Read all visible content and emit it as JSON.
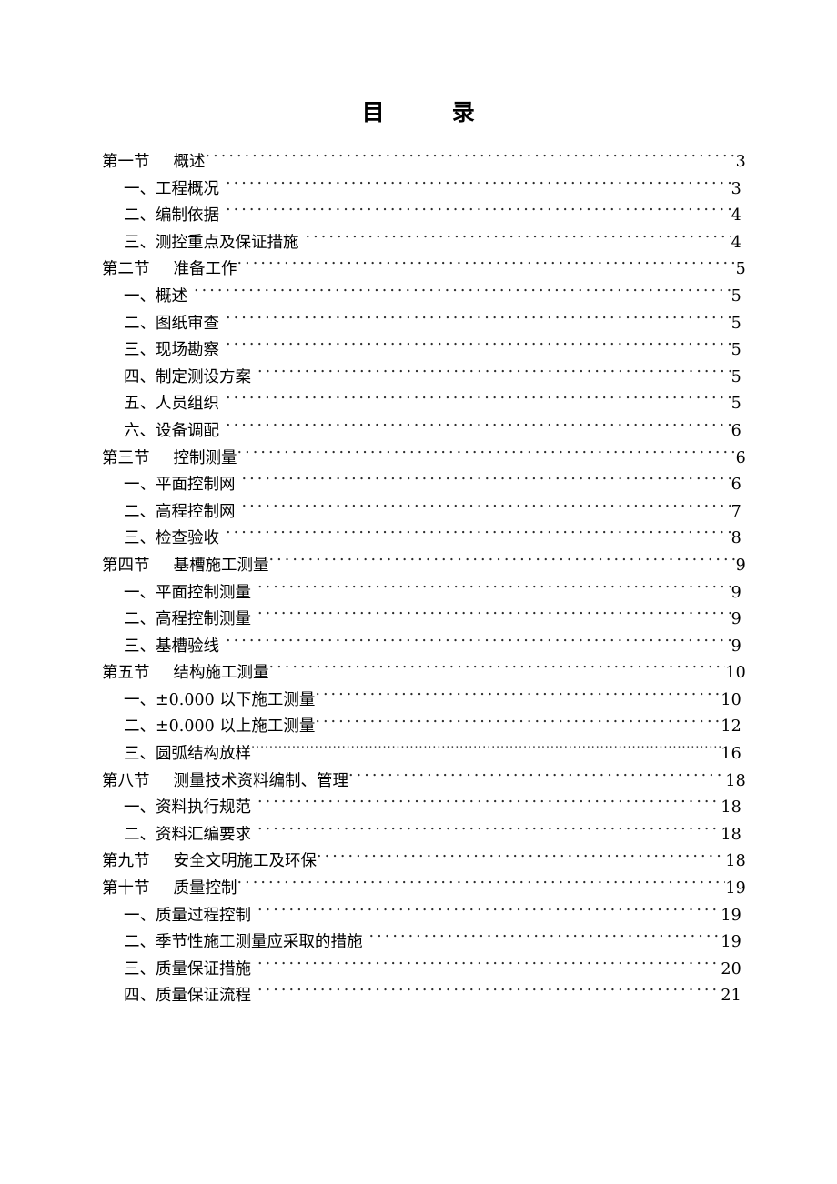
{
  "document": {
    "title": "目        录",
    "title_plain": "目 录"
  },
  "toc": {
    "entries": [
      {
        "level": 1,
        "section": "第一节",
        "text": "概述",
        "page": "3",
        "leader": "normal",
        "gap_before": false
      },
      {
        "level": 2,
        "section": "",
        "text": "一、工程概况",
        "page": "3",
        "leader": "normal",
        "gap_before": true
      },
      {
        "level": 2,
        "section": "",
        "text": "二、编制依据",
        "page": "4",
        "leader": "normal",
        "gap_before": true
      },
      {
        "level": 2,
        "section": "",
        "text": "三、测控重点及保证措施",
        "page": "4",
        "leader": "normal",
        "gap_before": true
      },
      {
        "level": 1,
        "section": "第二节",
        "text": "准备工作",
        "page": "5",
        "leader": "normal",
        "gap_before": false
      },
      {
        "level": 2,
        "section": "",
        "text": "一、概述",
        "page": "5",
        "leader": "normal",
        "gap_before": true
      },
      {
        "level": 2,
        "section": "",
        "text": "二、图纸审查",
        "page": "5",
        "leader": "normal",
        "gap_before": true
      },
      {
        "level": 2,
        "section": "",
        "text": "三、现场勘察",
        "page": "5",
        "leader": "normal",
        "gap_before": true
      },
      {
        "level": 2,
        "section": "",
        "text": "四、制定测设方案",
        "page": "5",
        "leader": "normal",
        "gap_before": true
      },
      {
        "level": 2,
        "section": "",
        "text": "五、人员组织",
        "page": "5",
        "leader": "normal",
        "gap_before": true
      },
      {
        "level": 2,
        "section": "",
        "text": "六、设备调配",
        "page": "6",
        "leader": "normal",
        "gap_before": true
      },
      {
        "level": 1,
        "section": "第三节",
        "text": "控制测量",
        "page": "6",
        "leader": "normal",
        "gap_before": false
      },
      {
        "level": 2,
        "section": "",
        "text": "一、平面控制网",
        "page": "6",
        "leader": "normal",
        "gap_before": true
      },
      {
        "level": 2,
        "section": "",
        "text": "二、高程控制网",
        "page": "7",
        "leader": "normal",
        "gap_before": true
      },
      {
        "level": 2,
        "section": "",
        "text": "三、检查验收",
        "page": "8",
        "leader": "normal",
        "gap_before": true
      },
      {
        "level": 1,
        "section": "第四节",
        "text": "基槽施工测量",
        "page": "9",
        "leader": "normal",
        "gap_before": false
      },
      {
        "level": 2,
        "section": "",
        "text": "一、平面控制测量",
        "page": "9",
        "leader": "normal",
        "gap_before": true
      },
      {
        "level": 2,
        "section": "",
        "text": "二、高程控制测量",
        "page": "9",
        "leader": "normal",
        "gap_before": true
      },
      {
        "level": 2,
        "section": "",
        "text": "三、基槽验线",
        "page": "9",
        "leader": "normal",
        "gap_before": true
      },
      {
        "level": 1,
        "section": "第五节",
        "text": "结构施工测量",
        "page": "10",
        "leader": "normal",
        "gap_before": false
      },
      {
        "level": 2,
        "section": "",
        "text": "一、±0.000 以下施工测量",
        "page": "10",
        "leader": "normal",
        "gap_before": false
      },
      {
        "level": 2,
        "section": "",
        "text": "二、±0.000 以上施工测量",
        "page": "12",
        "leader": "normal",
        "gap_before": false
      },
      {
        "level": 2,
        "section": "",
        "text": "三、圆弧结构放样",
        "page": "16",
        "leader": "fine",
        "gap_before": false
      },
      {
        "level": 1,
        "section": "第八节",
        "text": "测量技术资料编制、管理",
        "page": "18",
        "leader": "normal",
        "gap_before": false
      },
      {
        "level": 2,
        "section": "",
        "text": "一、资料执行规范",
        "page": "18",
        "leader": "normal",
        "gap_before": true
      },
      {
        "level": 2,
        "section": "",
        "text": "二、资料汇编要求",
        "page": "18",
        "leader": "normal",
        "gap_before": true
      },
      {
        "level": 1,
        "section": "第九节",
        "text": "安全文明施工及环保",
        "page": "18",
        "leader": "normal",
        "gap_before": false
      },
      {
        "level": 1,
        "section": "第十节",
        "text": "质量控制",
        "page": "19",
        "leader": "normal",
        "gap_before": false
      },
      {
        "level": 2,
        "section": "",
        "text": "一、质量过程控制",
        "page": "19",
        "leader": "normal",
        "gap_before": true
      },
      {
        "level": 2,
        "section": "",
        "text": "二、季节性施工测量应采取的措施",
        "page": "19",
        "leader": "normal",
        "gap_before": true
      },
      {
        "level": 2,
        "section": "",
        "text": "三、质量保证措施",
        "page": "20",
        "leader": "normal",
        "gap_before": true
      },
      {
        "level": 2,
        "section": "",
        "text": "四、质量保证流程",
        "page": "21",
        "leader": "normal",
        "gap_before": true
      }
    ]
  }
}
